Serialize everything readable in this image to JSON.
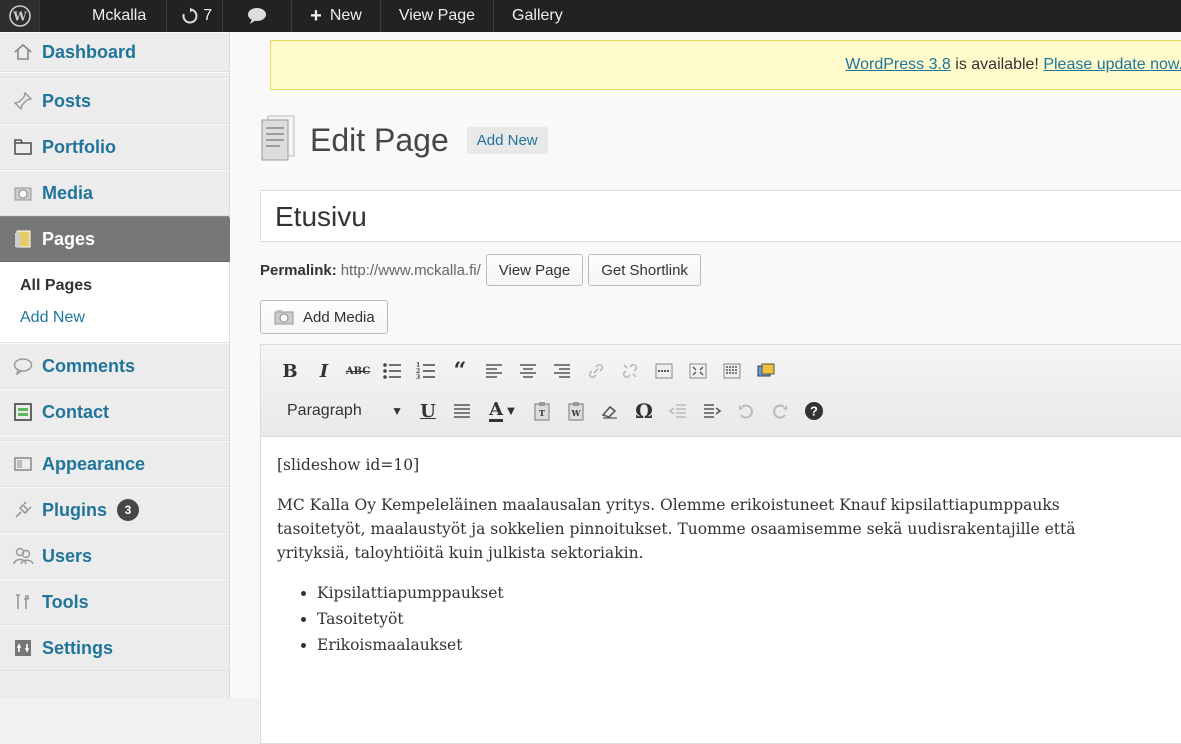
{
  "adminbar": {
    "logo_icon": "wordpress-logo-icon",
    "site_name": "Mckalla",
    "updates_count": "7",
    "comments_icon": "speech-bubble-icon",
    "new_label": "New",
    "view_page": "View Page",
    "gallery": "Gallery"
  },
  "sidebar": {
    "dashboard": "Dashboard",
    "posts": "Posts",
    "portfolio": "Portfolio",
    "media": "Media",
    "pages": "Pages",
    "pages_submenu": {
      "all_pages": "All Pages",
      "add_new": "Add New"
    },
    "comments": "Comments",
    "contact": "Contact",
    "appearance": "Appearance",
    "plugins": "Plugins",
    "plugins_badge": "3",
    "users": "Users",
    "tools": "Tools",
    "settings": "Settings"
  },
  "notice": {
    "version_link": "WordPress 3.8",
    "text": " is available! ",
    "update_link": "Please update now."
  },
  "page": {
    "heading": "Edit Page",
    "add_new": "Add New",
    "title_value": "Etusivu",
    "permalink_label": "Permalink:",
    "permalink_url": "http://www.mckalla.fi/",
    "view_page_button": "View Page",
    "shortlink_button": "Get Shortlink",
    "add_media_button": "Add Media"
  },
  "editor": {
    "format_select": "Paragraph",
    "content": {
      "shortcode": "[slideshow id=10]",
      "paragraph_lines": [
        "MC Kalla Oy Kempeleläinen maalausalan yritys.  Olemme erikoistuneet Knauf kipsilattiapumppauks",
        "tasoitetyöt, maalaustyöt ja sokkelien pinnoitukset. Tuomme osaamisemme sekä uudisrakentajille että",
        "yrityksiä, taloyhtiöitä kuin julkista sektoriakin."
      ],
      "list": [
        "Kipsilattiapumppaukset",
        "Tasoitetyöt",
        "Erikoismaalaukset"
      ]
    }
  },
  "colors": {
    "link": "#21759b",
    "adminbar_bg": "#222222",
    "notice_bg": "#fffbcc",
    "current_menu_bg": "#777777"
  }
}
